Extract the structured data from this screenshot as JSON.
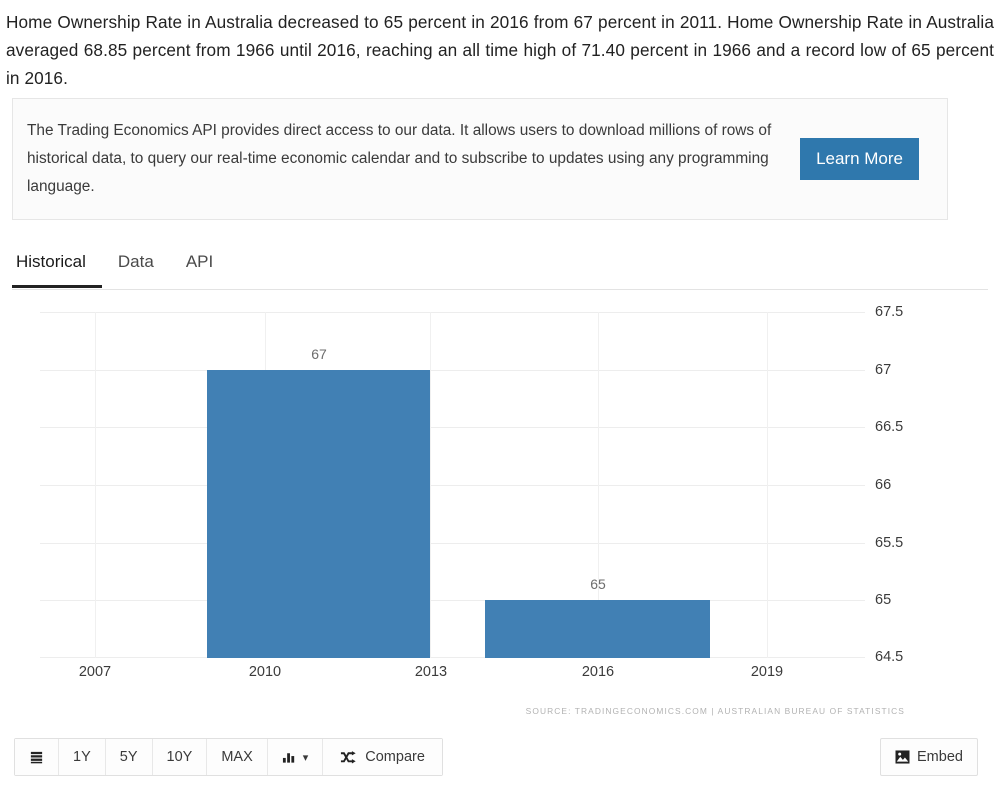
{
  "intro": {
    "paragraph": "Home Ownership Rate in Australia decreased to 65 percent in 2016 from 67 percent in 2011. Home Ownership Rate in Australia averaged 68.85 percent from 1966 until 2016, reaching an all time high of 71.40 percent in 1966 and a record low of 65 percent in 2016."
  },
  "api_promo": {
    "text": "The Trading Economics API provides direct access to our data. It allows users to download millions of rows of historical data, to query our real-time economic calendar and to subscribe to updates using any programming language.",
    "button_label": "Learn More",
    "button_color": "#2f78ad"
  },
  "tabs": [
    {
      "label": "Historical",
      "active": true
    },
    {
      "label": "Data",
      "active": false
    },
    {
      "label": "API",
      "active": false
    }
  ],
  "chart_data": {
    "type": "bar",
    "title": "",
    "xlabel": "",
    "ylabel": "",
    "categories": [
      "2011",
      "2016"
    ],
    "values": [
      67,
      65
    ],
    "data_labels": [
      "67",
      "65"
    ],
    "bar_color": "#4180b4",
    "ylim": [
      64.5,
      67.5
    ],
    "ytick_labels": [
      "67.5",
      "67",
      "66.5",
      "66",
      "65.5",
      "65",
      "64.5"
    ],
    "ytick_values": [
      67.5,
      67,
      66.5,
      66,
      65.5,
      65,
      64.5
    ],
    "xtick_labels": [
      "2007",
      "2010",
      "2013",
      "2016",
      "2019"
    ],
    "xtick_values": [
      2007,
      2010,
      2013,
      2016,
      2019
    ],
    "xlim": [
      2005.6,
      2020.2
    ],
    "grid": true,
    "legend": "none",
    "y_axis_position": "right",
    "source": "SOURCE: TRADINGECONOMICS.COM | AUSTRALIAN BUREAU OF STATISTICS"
  },
  "toolbar": {
    "list_icon": "list-icon",
    "ranges": [
      "1Y",
      "5Y",
      "10Y",
      "MAX"
    ],
    "chart_type_icon": "bar-chart-icon",
    "chart_type_caret": "▾",
    "compare_icon": "shuffle-icon",
    "compare_label": "Compare",
    "embed_icon": "image-icon",
    "embed_label": "Embed"
  }
}
